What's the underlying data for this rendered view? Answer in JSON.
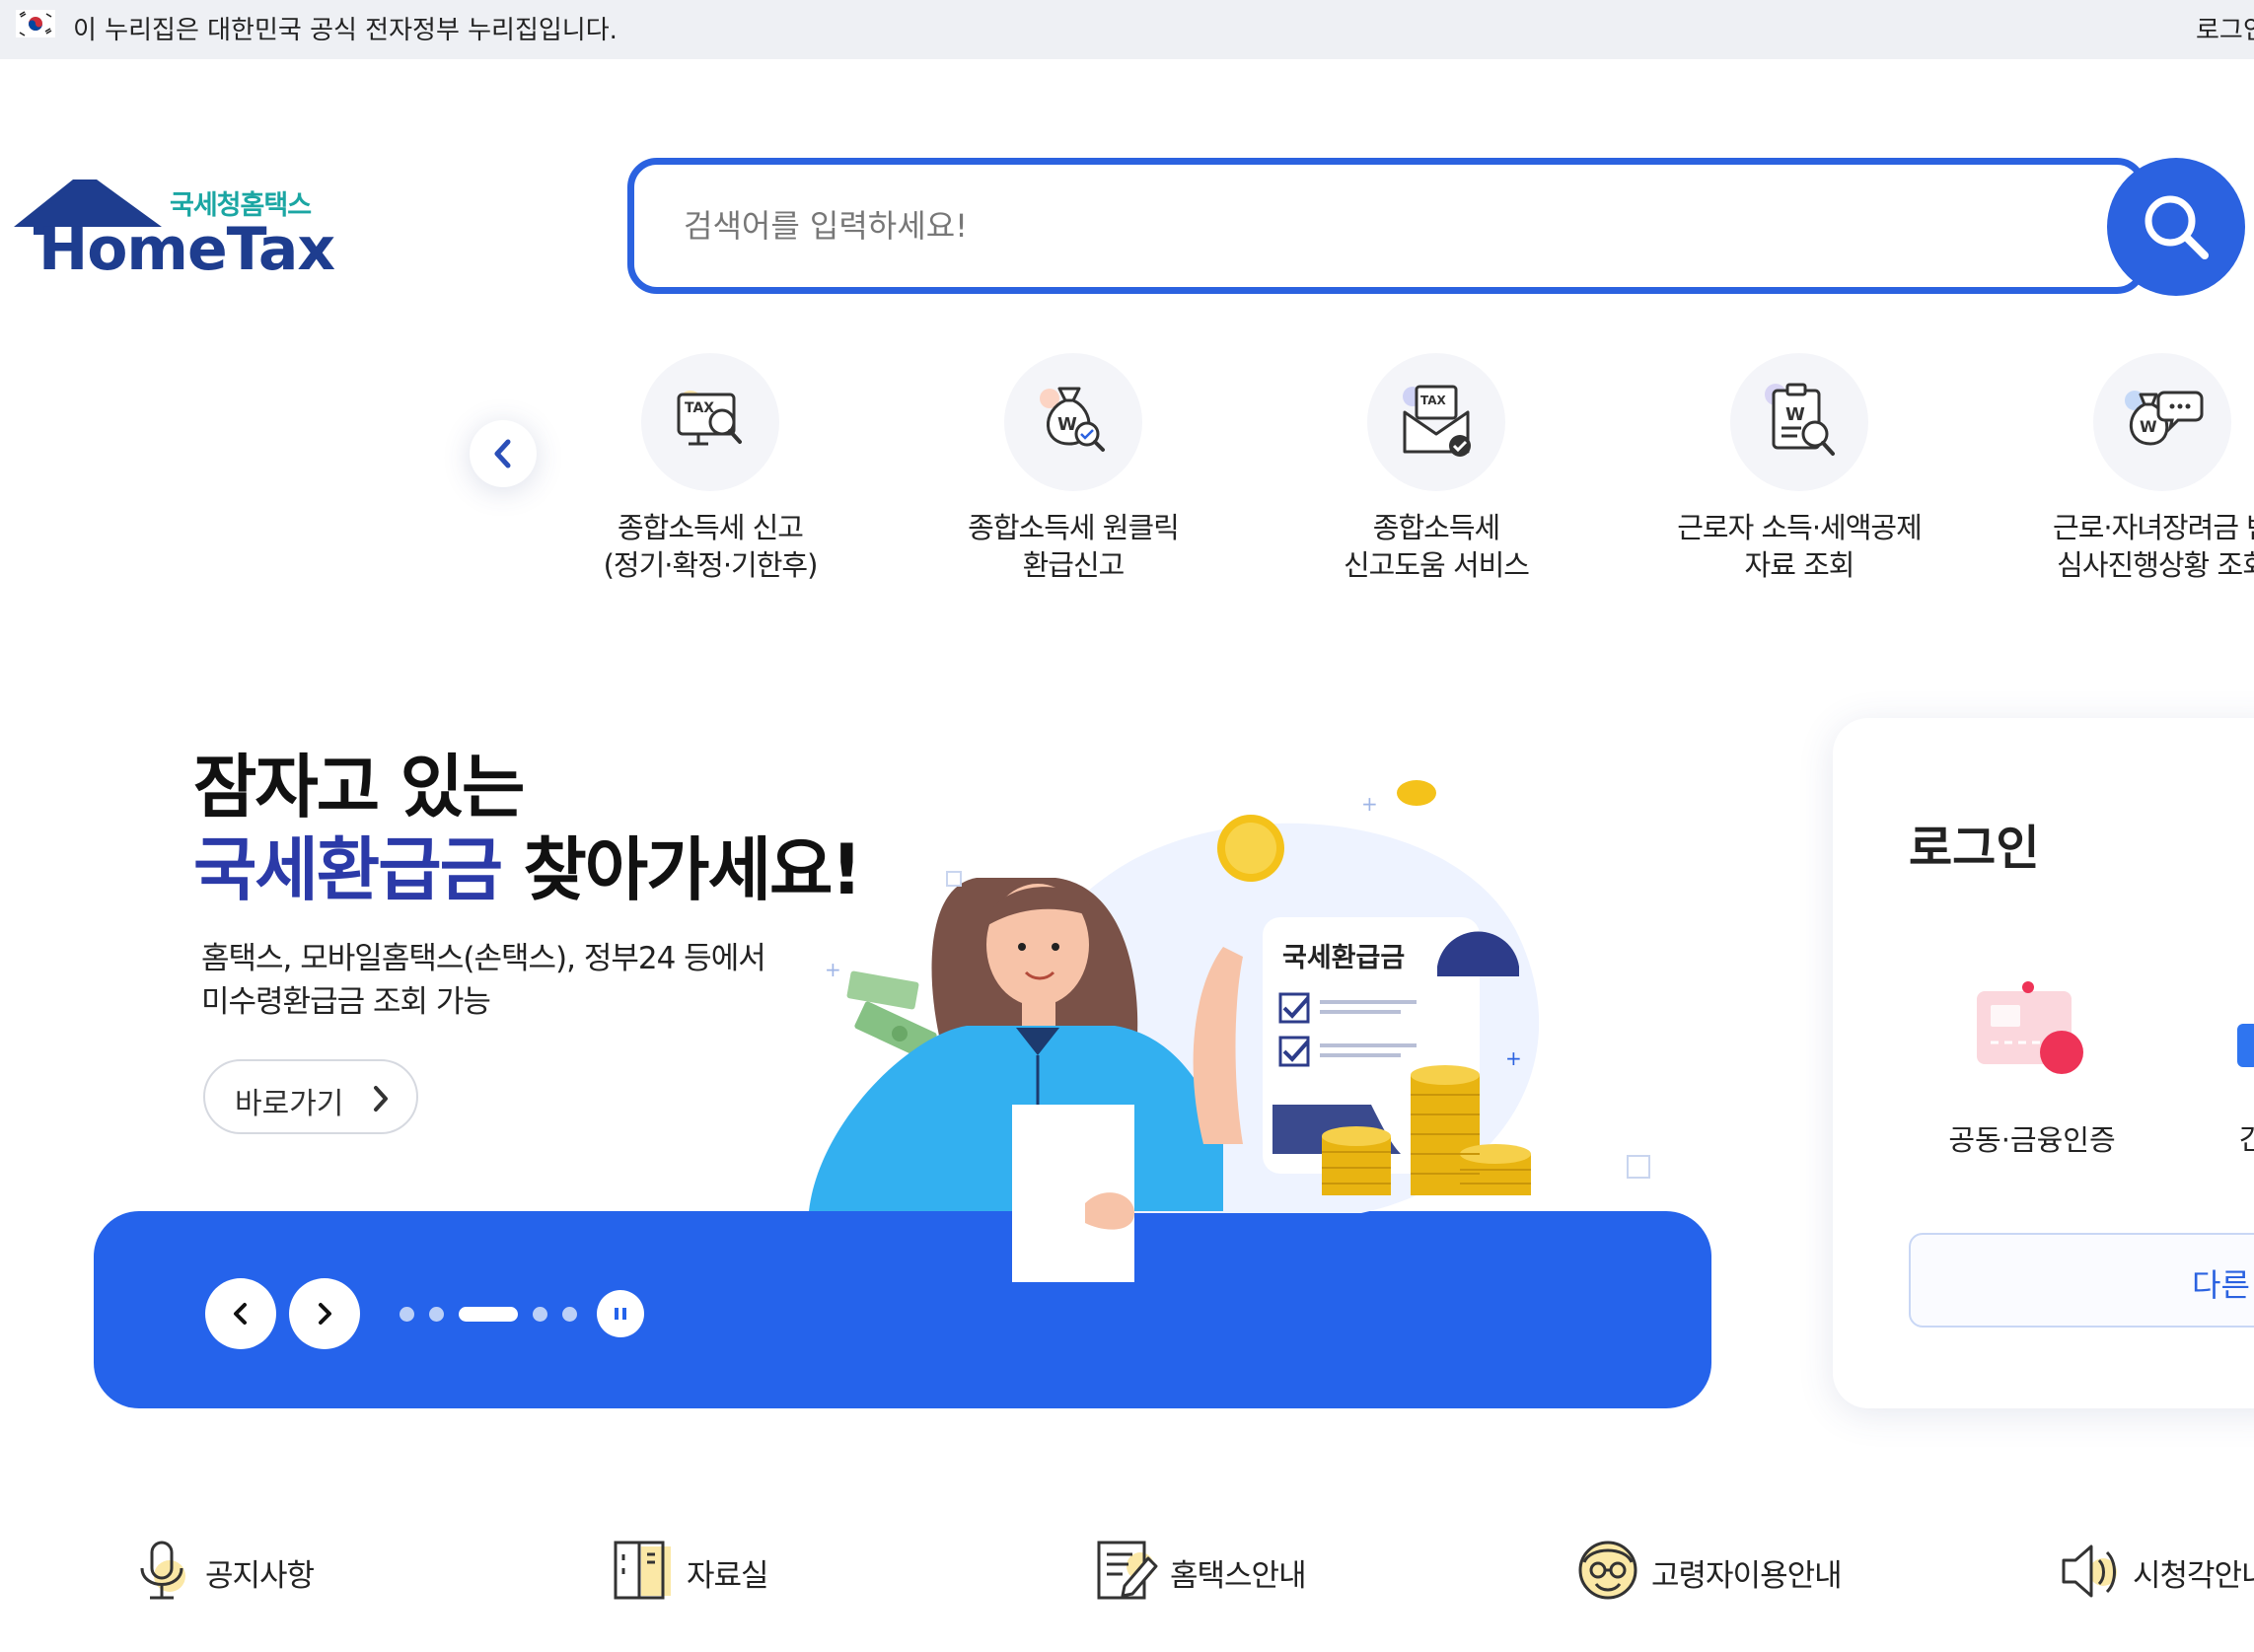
{
  "gov_bar": {
    "notice": "이 누리집은 대한민국 공식 전자정부 누리집입니다.",
    "login": "로그인"
  },
  "logo": {
    "sub": "국세청홈택스",
    "main": "HomeTax"
  },
  "search": {
    "placeholder": "검색어를 입력하세요!"
  },
  "quick_menu": [
    {
      "line1": "종합소득세 신고",
      "line2": "(정기·확정·기한후)",
      "icon": "tax-monitor-search-icon"
    },
    {
      "line1": "종합소득세 원클릭",
      "line2": "환급신고",
      "icon": "money-bag-search-icon"
    },
    {
      "line1": "종합소득세",
      "line2": "신고도움 서비스",
      "icon": "tax-mail-check-icon"
    },
    {
      "line1": "근로자 소득·세액공제",
      "line2": "자료 조회",
      "icon": "document-search-icon"
    },
    {
      "line1": "근로·자녀장려금 반",
      "line2": "심사진행상황 조회",
      "icon": "money-bag-chat-icon"
    }
  ],
  "hero": {
    "title_line1": "잠자고 있는",
    "title_highlight": "국세환급금",
    "title_rest": " 찾아가세요!",
    "desc_line1": "홈택스, 모바일홈택스(손택스), 정부24 등에서",
    "desc_line2": "미수령환급금 조회 가능",
    "go_label": "바로가기",
    "illus_label": "국세환급금",
    "slides_total": 5,
    "slide_active": 3
  },
  "login_card": {
    "title": "로그인",
    "cert_label": "공동·금융인증",
    "other_partial": "간",
    "other_label": "다른"
  },
  "bottom_links": [
    {
      "label": "공지사항",
      "icon": "microphone-icon"
    },
    {
      "label": "자료실",
      "icon": "archive-icon"
    },
    {
      "label": "홈택스안내",
      "icon": "document-edit-icon"
    },
    {
      "label": "고령자이용안내",
      "icon": "senior-face-icon"
    },
    {
      "label": "시청각안내",
      "icon": "speaker-icon"
    }
  ],
  "colors": {
    "primary": "#2563eb",
    "logo_blue": "#1e3d8f",
    "logo_teal": "#1ba6a3",
    "headline_highlight": "#2b3aa8"
  }
}
